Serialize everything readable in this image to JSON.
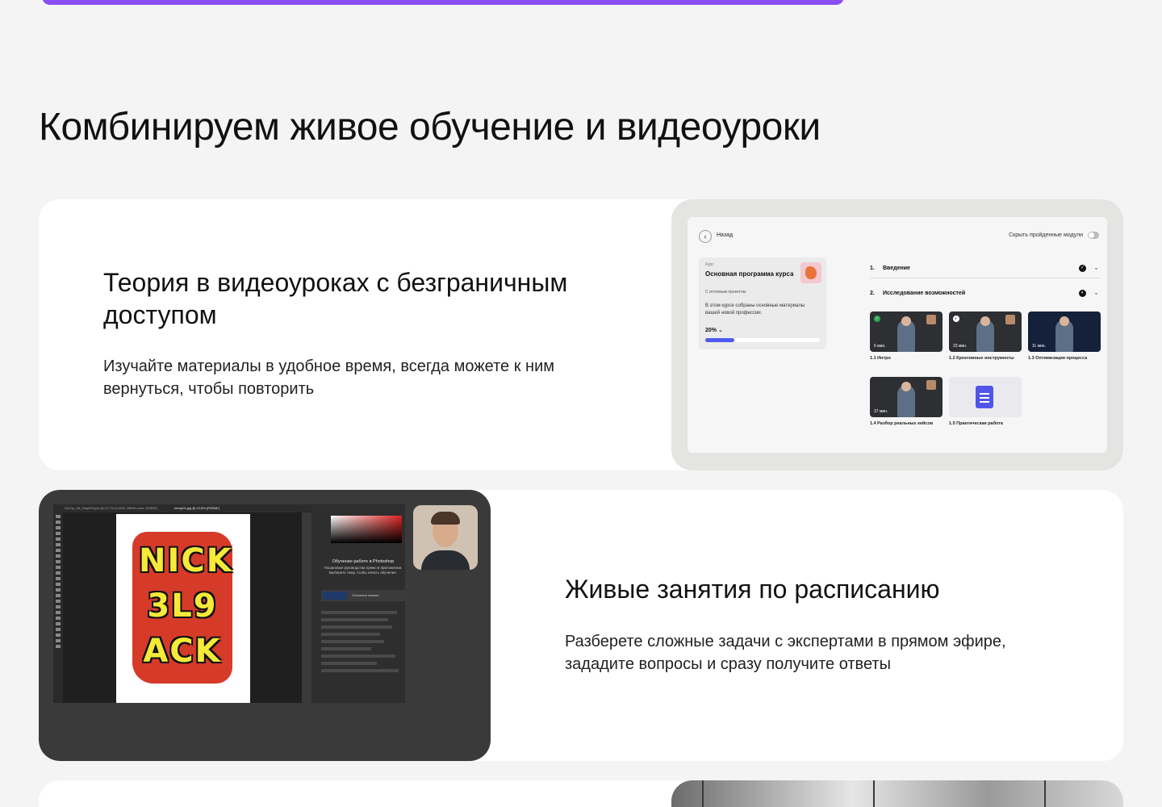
{
  "section": {
    "title": "Комбинируем живое обучение и видеоуроки"
  },
  "cards": [
    {
      "title": "Теория в видеоуроках с безграничным доступом",
      "text": "Изучайте материалы в удобное время, всегда можете к ним вернуться, чтобы повторить"
    },
    {
      "title": "Живые занятия по расписанию",
      "text": "Разберете сложные задачи с экспертами в прямом эфире, зададите вопросы и сразу получите ответы"
    }
  ],
  "course_mockup": {
    "back_label": "Назад",
    "hide_completed_label": "Скрыть пройденные модули",
    "course": {
      "kicker": "Курс",
      "title": "Основная программа курса",
      "badge": "С итоговым проектом",
      "description": "В этом курсе собраны основные материалы вашей новой профессии.",
      "progress_label": "20% ⌄",
      "progress_fraction": 0.25
    },
    "modules": [
      {
        "num": "1.",
        "label": "Введение"
      },
      {
        "num": "2.",
        "label": "Исследование возможностей"
      }
    ],
    "lessons": [
      {
        "label": "1.1 Интро",
        "duration": "6 мин."
      },
      {
        "label": "1.2 Креативные инструменты",
        "duration": "23 мин."
      },
      {
        "label": "1.3 Оптимизация процесса",
        "duration": "11 мин."
      },
      {
        "label": "1.4 Разбор реальных кейсов",
        "duration": "37 мин."
      },
      {
        "label": "1.5 Практическая работа",
        "duration": ""
      }
    ]
  },
  "photoshop_mockup": {
    "tab_1": "24e7rp_9d_0mpd09.psd @ 12,7% (LOGO, MENA cmm, RGB/8*)",
    "tab_2": "Intrup01.jpg @ 12,5% (RGB/8*)",
    "art_lines": [
      "NICK",
      "3L9",
      "ACK"
    ],
    "learn_title": "Обучение работе в Photoshop",
    "learn_text": "Пошаговые руководства прямо в приложении. Выберите тему, чтобы начать обучение.",
    "lesson_label": "Основные навыки"
  }
}
